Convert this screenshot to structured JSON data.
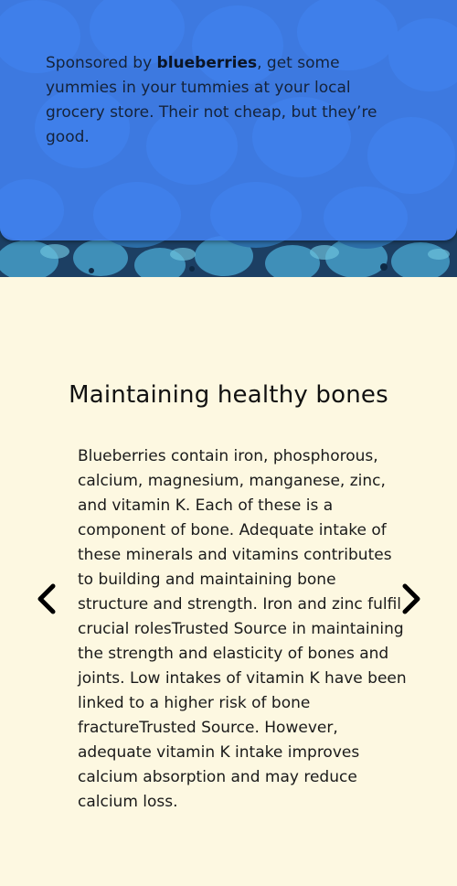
{
  "sponsor": {
    "prefix": "Sponsored by ",
    "brand": "blueberries",
    "suffix": ", get some yummies in your tummies at your local grocery store. Their not cheap, but they’re good."
  },
  "carousel": {
    "title": "Maintaining healthy bones",
    "body": "Blueberries contain iron, phosphorous, calcium, magnesium, manganese, zinc, and vitamin K. Each of these is a component of bone. Adequate intake of these minerals and vitamins contributes to building and maintaining bone structure and strength. Iron and zinc fulfil crucial rolesTrusted Source in maintaining the strength and elasticity of bones and joints. Low intakes of vitamin K have been linked to a higher risk of bone fractureTrusted Source. However, adequate vitamin K intake improves calcium absorption and may reduce calcium loss.",
    "prev_icon": "chevron-left-icon",
    "next_icon": "chevron-right-icon"
  },
  "colors": {
    "page_background": "#fdf8e1",
    "card_overlay": "#4282f5",
    "berry_dark": "#1f4d7a",
    "berry_light": "#4fa3c7"
  }
}
